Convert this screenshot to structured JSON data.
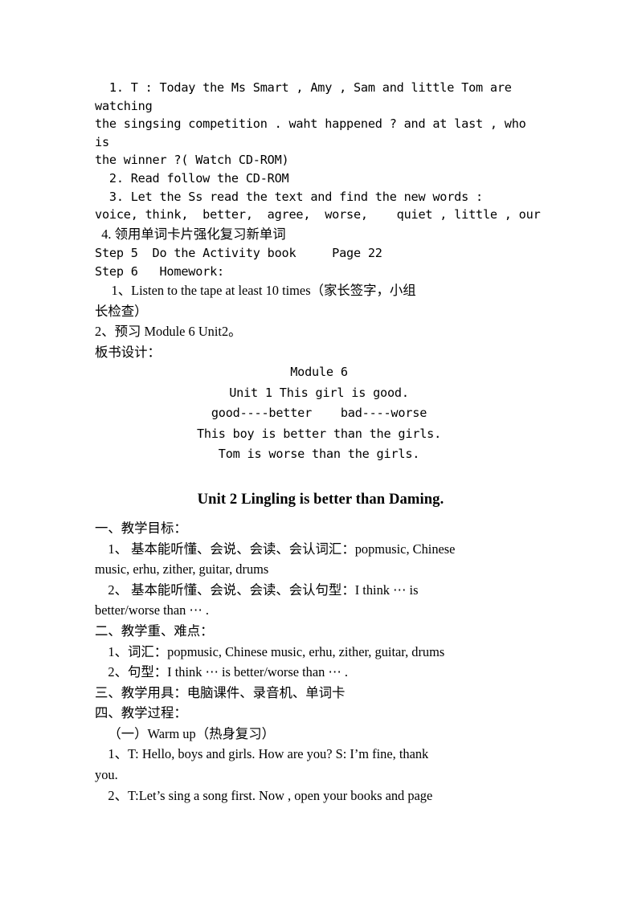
{
  "document": {
    "type": "lesson-plan",
    "page_background": "#ffffff",
    "text_color": "#000000"
  },
  "section_a": {
    "lines": [
      "  1. T : Today the Ms Smart , Amy , Sam and little Tom are watching\nthe singsing competition . waht happened ? and at last , who is\nthe winner ?( Watch CD-ROM)",
      "  2. Read follow the CD-ROM",
      "  3. Let the Ss read the text and find the new words :\nvoice, think,  better,  agree,  worse,    quiet , little , our"
    ],
    "line_4": "  4. 领用单词卡片强化复习新单词",
    "step5": "Step 5  Do the Activity book     Page 22",
    "step6": "Step 6   Homework:",
    "homework_1": "     1、Listen to the tape at least 10 times（家长签字，小组\n长检查）",
    "homework_2": "2、预习 Module 6 Unit2。",
    "board_label": "板书设计："
  },
  "blackboard": {
    "lines": [
      "Module 6",
      "Unit 1 This girl is good.",
      "good----better    bad----worse",
      "This boy is better than the girls.",
      "Tom is worse than the girls."
    ]
  },
  "unit2": {
    "heading": "Unit 2 Lingling is better than Daming."
  },
  "section_b": {
    "objectives_label": "一、教学目标：",
    "objective_1": "    1、 基本能听懂、会说、会读、会认词汇：popmusic, Chinese\nmusic, erhu, zither, guitar, drums",
    "objective_2": "    2、 基本能听懂、会说、会读、会认句型：I think ⋯ is\nbetter/worse than ⋯ .",
    "keypoints_label": "二、教学重、难点：",
    "keypoint_1": "    1、词汇：popmusic, Chinese music, erhu, zither, guitar, drums",
    "keypoint_2": "    2、句型：I think ⋯ is better/worse than ⋯ .",
    "tools_label": "三、教学用具：电脑课件、录音机、单词卡",
    "process_label": "四、教学过程：",
    "warmup_label": "    （一）Warm up（热身复习）",
    "warmup_1": "    1、T: Hello, boys and girls. How are you? S: I’m fine, thank\nyou.",
    "warmup_2": "    2、T:Let’s sing a song first. Now , open your books and page"
  }
}
